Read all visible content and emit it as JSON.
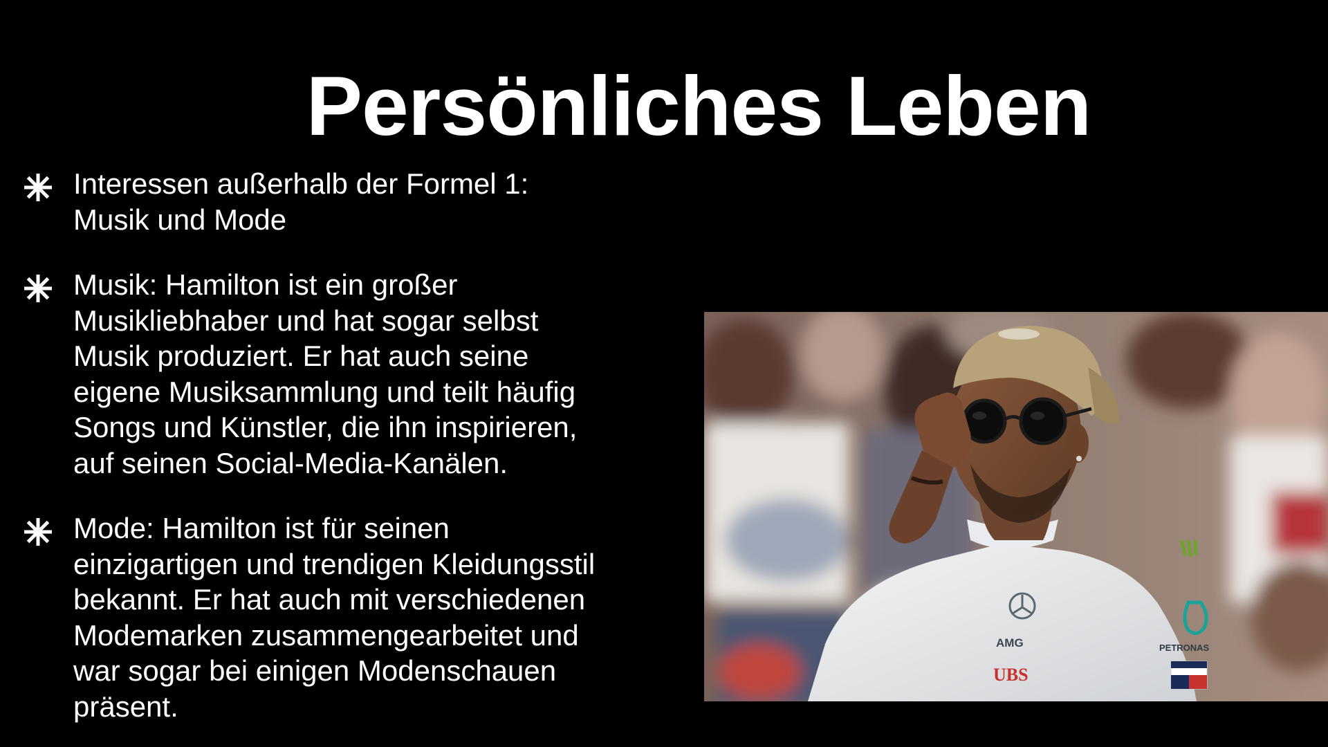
{
  "slide": {
    "title": "Persönliches Leben",
    "bullet_icon": "asterisk-icon",
    "bullets": [
      {
        "lines": [
          "Interessen außerhalb der Formel 1:",
          "Musik und Mode"
        ]
      },
      {
        "lines": [
          "Musik: Hamilton ist ein großer",
          "Musikliebhaber und hat sogar selbst",
          "Musik produziert. Er hat auch seine",
          "eigene Musiksammlung und teilt häufig",
          "Songs und Künstler, die ihn inspirieren,",
          "auf seinen Social-Media-Kanälen."
        ]
      },
      {
        "lines": [
          "Mode: Hamilton ist für seinen",
          "einzigartigen und trendigen Kleidungsstil",
          "bekannt. Er hat auch mit verschiedenen",
          "Modemarken zusammengearbeitet und",
          "war sogar bei einigen Modenschauen",
          "präsent."
        ]
      }
    ],
    "photo": {
      "logos": {
        "amg": "AMG",
        "ubs": "UBS",
        "petronas": "PETRONAS"
      }
    }
  },
  "colors": {
    "background": "#000000",
    "text": "#ffffff"
  }
}
